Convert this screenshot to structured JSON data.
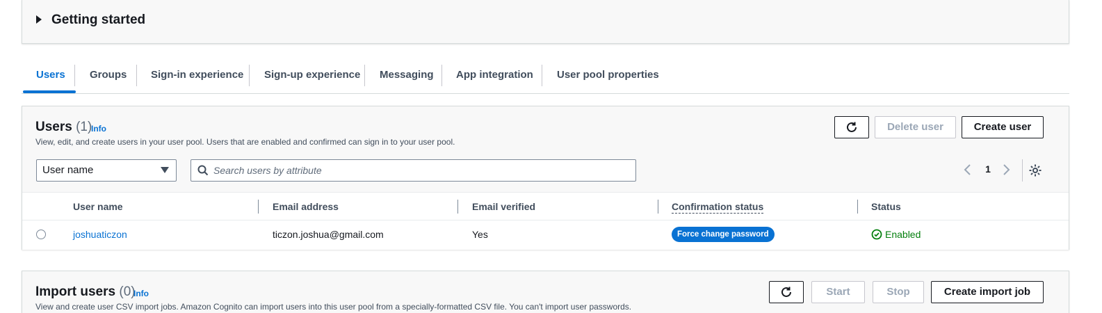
{
  "getting_started": {
    "title": "Getting started"
  },
  "tabs": [
    {
      "label": "Users"
    },
    {
      "label": "Groups"
    },
    {
      "label": "Sign-in experience"
    },
    {
      "label": "Sign-up experience"
    },
    {
      "label": "Messaging"
    },
    {
      "label": "App integration"
    },
    {
      "label": "User pool properties"
    }
  ],
  "users": {
    "title": "Users",
    "count": "(1)",
    "info": "Info",
    "description": "View, edit, and create users in your user pool. Users that are enabled and confirmed can sign in to your user pool.",
    "delete_label": "Delete user",
    "create_label": "Create user",
    "filter_select": "User name",
    "search_placeholder": "Search users by attribute",
    "page": "1",
    "columns": [
      "User name",
      "Email address",
      "Email verified",
      "Confirmation status",
      "Status"
    ],
    "rows": [
      {
        "username": "joshuaticzon",
        "email": "ticzon.joshua@gmail.com",
        "email_verified": "Yes",
        "confirmation_status": "Force change password",
        "status": "Enabled"
      }
    ]
  },
  "import_users": {
    "title": "Import users",
    "count": "(0)",
    "info": "Info",
    "description": "View and create user CSV import jobs. Amazon Cognito can import users into this user pool from a specially-formatted CSV file. You can't import user passwords.",
    "start_label": "Start",
    "stop_label": "Stop",
    "create_label": "Create import job"
  },
  "colors": {
    "accent": "#0972d3",
    "success": "#037f0c",
    "badge": "#0972d3"
  },
  "icons": {
    "refresh": "refresh-icon",
    "search": "search-icon",
    "settings": "gear-icon",
    "prev": "chevron-left-icon",
    "next": "chevron-right-icon",
    "status_ok": "check-circle-icon"
  }
}
